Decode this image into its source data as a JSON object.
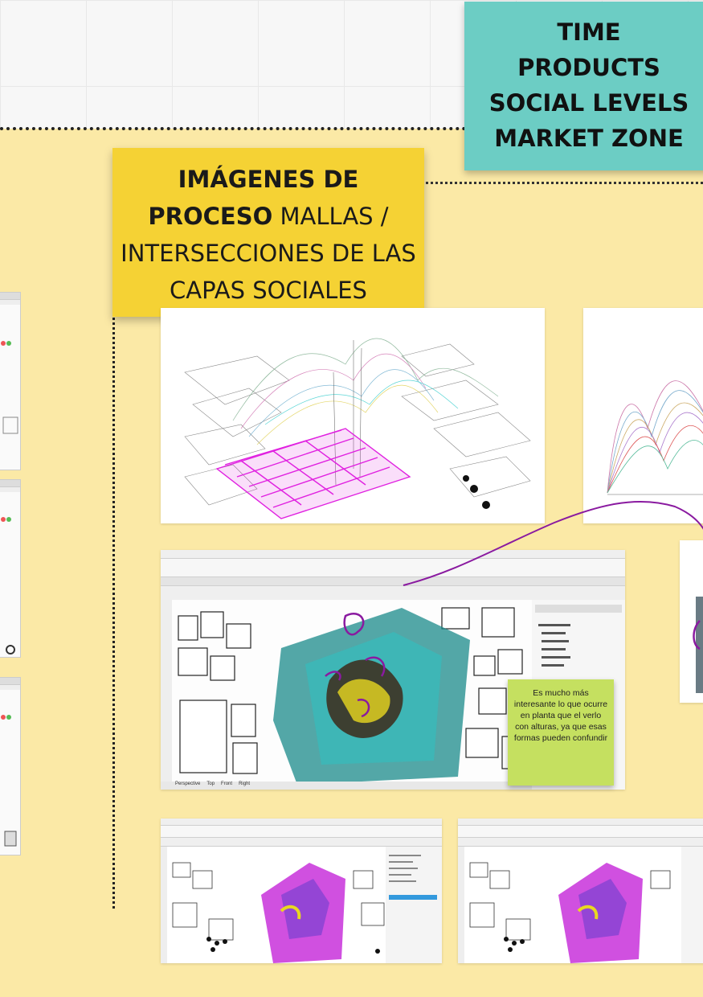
{
  "teal_note": {
    "lines": [
      "TIME",
      "PRODUCTS",
      "SOCIAL LEVELS",
      "MARKET ZONE"
    ]
  },
  "yellow_note": {
    "bold": "IMÁGENES DE PROCESO",
    "regular": "MALLAS / INTERSECCIONES DE LAS CAPAS SOCIALES"
  },
  "green_note": {
    "text": "Es mucho más interesante lo que ocurre en planta que el verlo con alturas, ya que esas formas pueden confundir"
  },
  "colors": {
    "board_yellow": "#fbe9a6",
    "teal": "#6ccdc4",
    "sticky_yellow": "#f5d234",
    "green": "#c5e060",
    "magenta": "#e020e0",
    "purple_line": "#8a1aa0"
  },
  "screenshots": {
    "main": {
      "tabs": [
        "Perspective",
        "Top",
        "Front",
        "Right"
      ]
    }
  }
}
